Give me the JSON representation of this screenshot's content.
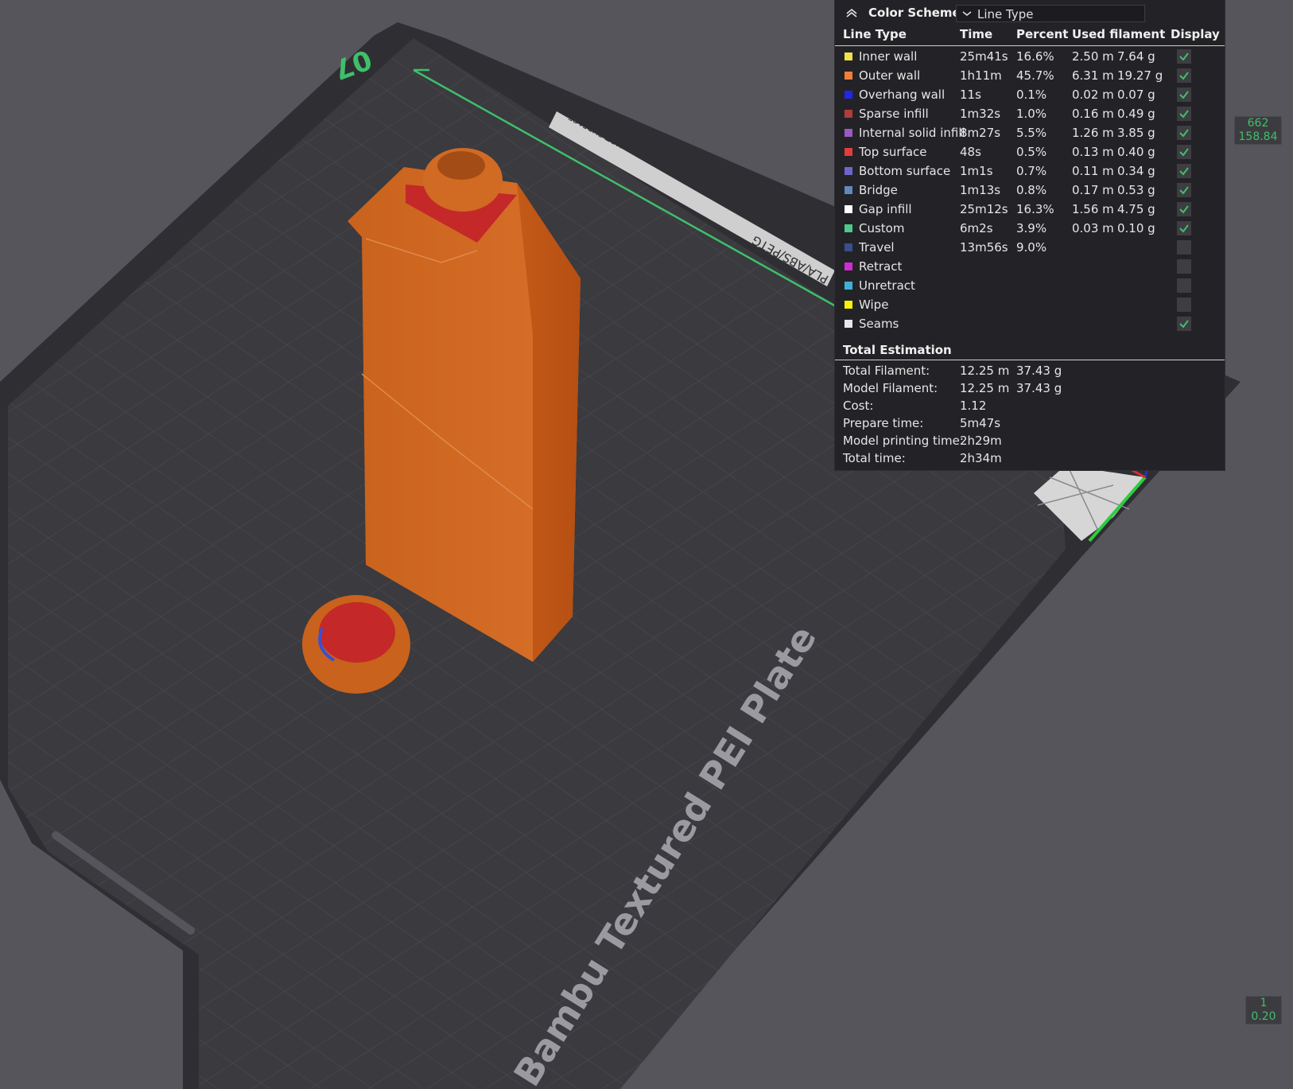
{
  "plate": {
    "name": "Bambu Textured PEI Plate",
    "plate_number": "07",
    "hot_surface": "HOT SURFACE",
    "material_hint": "PLA/ABS/PETG"
  },
  "legend": {
    "title": "Color Scheme",
    "scheme_value": "Line Type",
    "columns": [
      "Line Type",
      "Time",
      "Percent",
      "Used filament",
      "Display"
    ],
    "rows": [
      {
        "name": "Inner wall",
        "color": "#f2e24a",
        "time": "25m41s",
        "percent": "16.6%",
        "length": "2.50 m",
        "weight": "7.64 g",
        "display": true
      },
      {
        "name": "Outer wall",
        "color": "#f07f38",
        "time": "1h11m",
        "percent": "45.7%",
        "length": "6.31 m",
        "weight": "19.27 g",
        "display": true
      },
      {
        "name": "Overhang wall",
        "color": "#2226e6",
        "time": "11s",
        "percent": "0.1%",
        "length": "0.02 m",
        "weight": "0.07 g",
        "display": true
      },
      {
        "name": "Sparse infill",
        "color": "#b33b3b",
        "time": "1m32s",
        "percent": "1.0%",
        "length": "0.16 m",
        "weight": "0.49 g",
        "display": true
      },
      {
        "name": "Internal solid infill",
        "color": "#9a5ac2",
        "time": "8m27s",
        "percent": "5.5%",
        "length": "1.26 m",
        "weight": "3.85 g",
        "display": true
      },
      {
        "name": "Top surface",
        "color": "#e63b3b",
        "time": "48s",
        "percent": "0.5%",
        "length": "0.13 m",
        "weight": "0.40 g",
        "display": true
      },
      {
        "name": "Bottom surface",
        "color": "#6e65cc",
        "time": "1m1s",
        "percent": "0.7%",
        "length": "0.11 m",
        "weight": "0.34 g",
        "display": true
      },
      {
        "name": "Bridge",
        "color": "#5f89b8",
        "time": "1m13s",
        "percent": "0.8%",
        "length": "0.17 m",
        "weight": "0.53 g",
        "display": true
      },
      {
        "name": "Gap infill",
        "color": "#ffffff",
        "time": "25m12s",
        "percent": "16.3%",
        "length": "1.56 m",
        "weight": "4.75 g",
        "display": true
      },
      {
        "name": "Custom",
        "color": "#4cc98a",
        "time": "6m2s",
        "percent": "3.9%",
        "length": "0.03 m",
        "weight": "0.10 g",
        "display": true
      },
      {
        "name": "Travel",
        "color": "#3b4c8f",
        "time": "13m56s",
        "percent": "9.0%",
        "length": "",
        "weight": "",
        "display": false
      },
      {
        "name": "Retract",
        "color": "#d12cd1",
        "time": "",
        "percent": "",
        "length": "",
        "weight": "",
        "display": false
      },
      {
        "name": "Unretract",
        "color": "#3fb1d6",
        "time": "",
        "percent": "",
        "length": "",
        "weight": "",
        "display": false
      },
      {
        "name": "Wipe",
        "color": "#f6f20a",
        "time": "",
        "percent": "",
        "length": "",
        "weight": "",
        "display": false
      },
      {
        "name": "Seams",
        "color": "#e8e8e8",
        "time": "",
        "percent": "",
        "length": "",
        "weight": "",
        "display": true
      }
    ],
    "total": {
      "title": "Total Estimation",
      "items": [
        {
          "label": "Total Filament:",
          "v1": "12.25 m",
          "v2": "37.43 g"
        },
        {
          "label": "Model Filament:",
          "v1": "12.25 m",
          "v2": "37.43 g"
        },
        {
          "label": "Cost:",
          "v1": "1.12",
          "v2": ""
        },
        {
          "label": "Prepare time:",
          "v1": "5m47s",
          "v2": ""
        },
        {
          "label": "Model printing time:",
          "v1": "2h29m",
          "v2": ""
        },
        {
          "label": "Total time:",
          "v1": "2h34m",
          "v2": ""
        }
      ]
    }
  },
  "layer_slider": {
    "top_layer": "662",
    "top_height": "158.84",
    "bottom_layer": "1",
    "bottom_height": "0.20"
  }
}
